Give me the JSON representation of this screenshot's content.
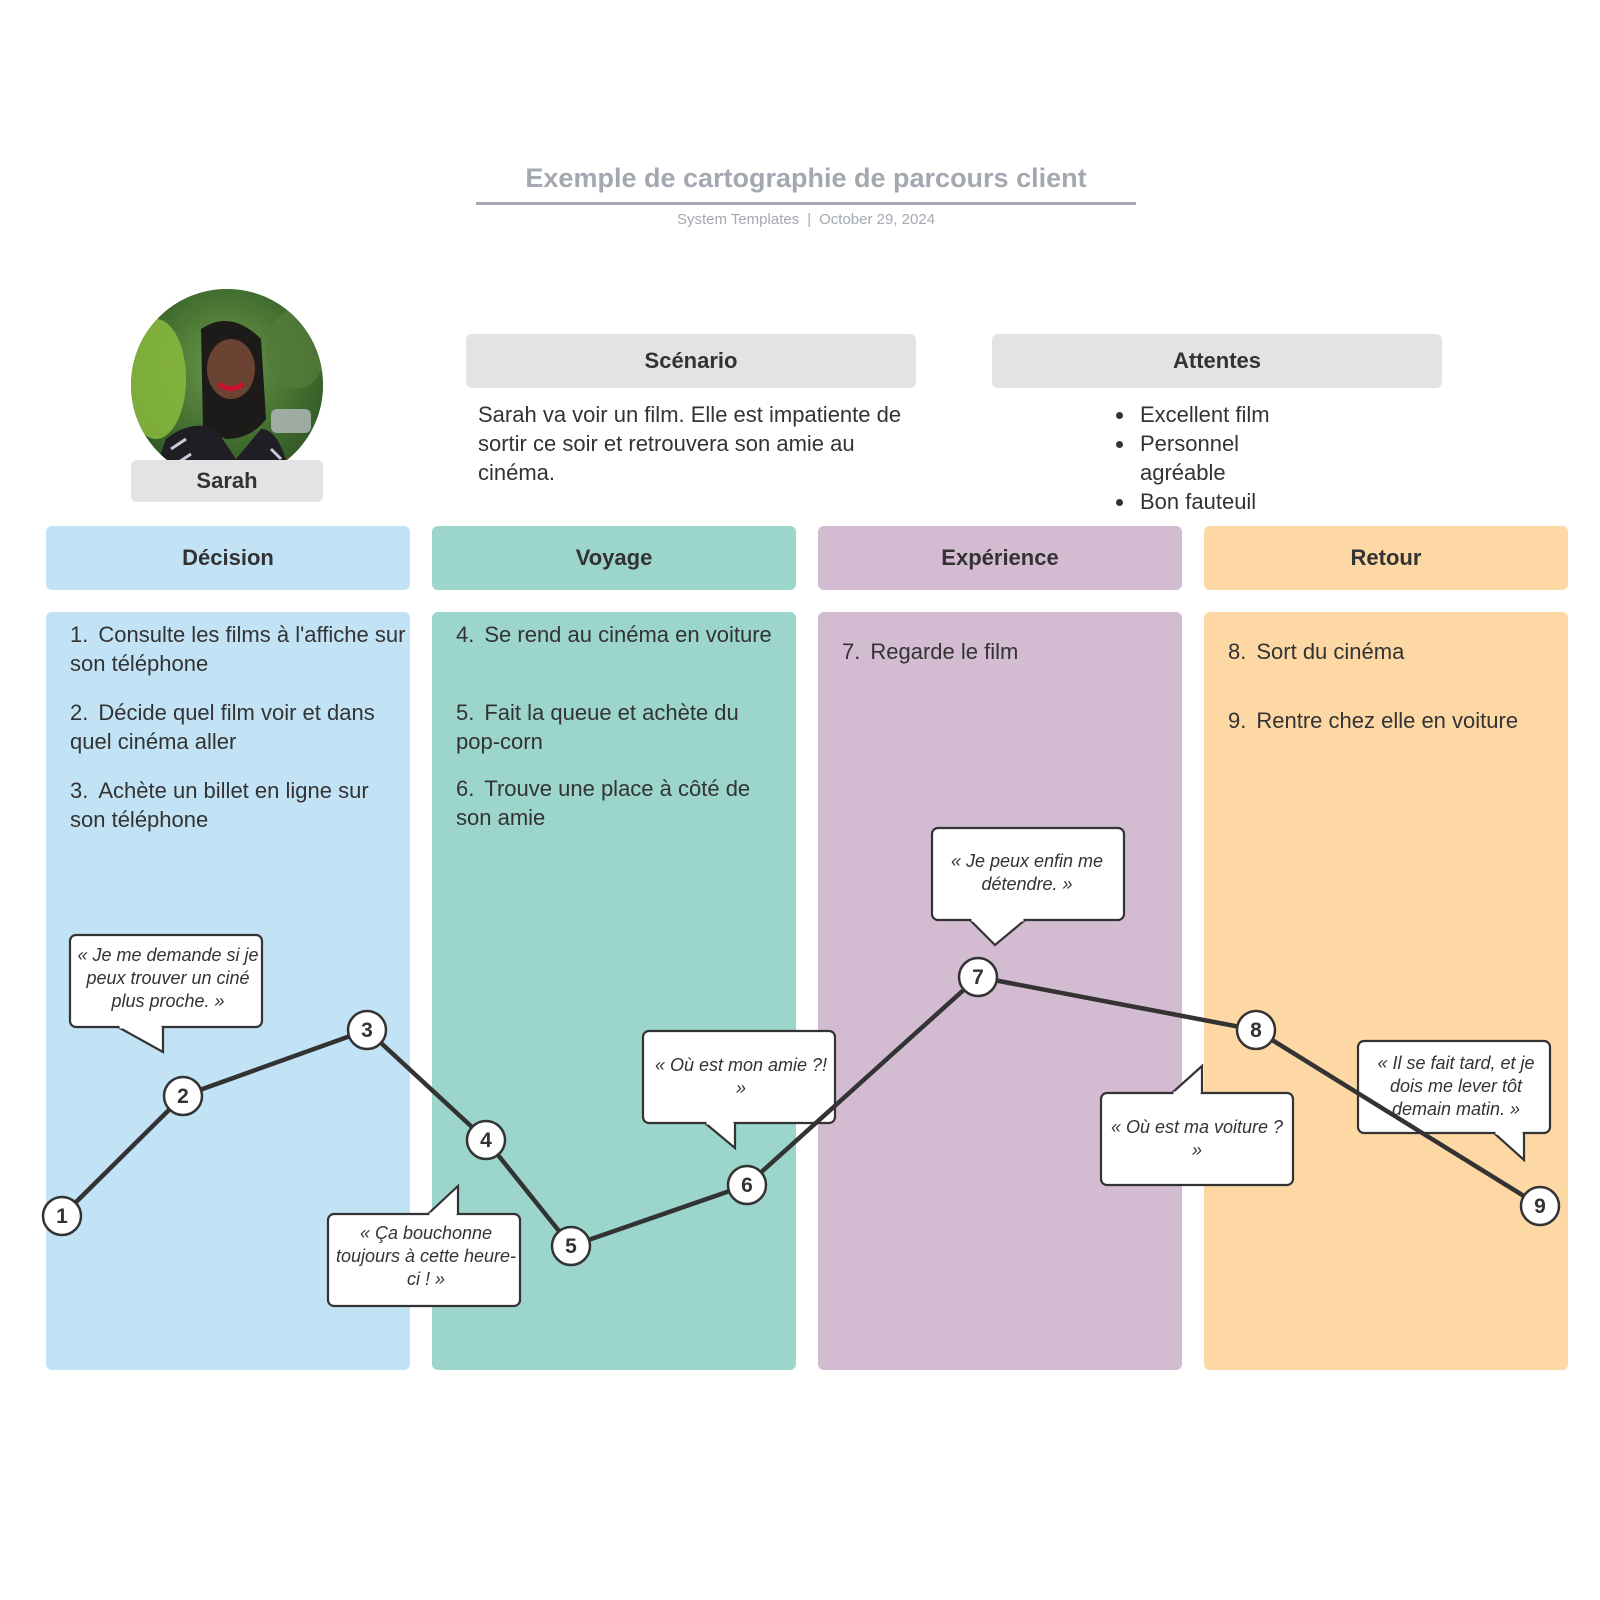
{
  "header": {
    "title": "Exemple de cartographie de parcours client",
    "source": "System Templates",
    "separator": "|",
    "date": "October 29, 2024"
  },
  "persona": {
    "name": "Sarah",
    "photo_icon": "persona-photo"
  },
  "scenario": {
    "heading": "Scénario",
    "text": "Sarah va voir un film. Elle est impatiente de sortir ce soir et retrouvera son amie au cinéma."
  },
  "expectations": {
    "heading": "Attentes",
    "items": [
      "Excellent film",
      "Personnel agréable",
      "Bon fauteuil"
    ]
  },
  "phases": [
    {
      "label": "Décision",
      "color": "#c2e3f5"
    },
    {
      "label": "Voyage",
      "color": "#9bd5cb"
    },
    {
      "label": "Expérience",
      "color": "#d3bbd2"
    },
    {
      "label": "Retour",
      "color": "#fdd8a5"
    }
  ],
  "steps": [
    {
      "num": "1.",
      "text": "Consulte les films à l'affiche sur son téléphone",
      "phase": 0
    },
    {
      "num": "2.",
      "text": "Décide quel film voir et dans quel cinéma aller",
      "phase": 0
    },
    {
      "num": "3.",
      "text": "Achète un billet en ligne sur son téléphone",
      "phase": 0
    },
    {
      "num": "4.",
      "text": "Se rend au cinéma en voiture",
      "phase": 1
    },
    {
      "num": "5.",
      "text": "Fait la queue et achète du pop-corn",
      "phase": 1
    },
    {
      "num": "6.",
      "text": "Trouve une place à côté de son amie",
      "phase": 1
    },
    {
      "num": "7.",
      "text": "Regarde le film",
      "phase": 2
    },
    {
      "num": "8.",
      "text": "Sort du cinéma",
      "phase": 3
    },
    {
      "num": "9.",
      "text": "Rentre chez elle en voiture",
      "phase": 3
    }
  ],
  "journey": {
    "line_color": "#333333",
    "points": [
      {
        "label": "1",
        "step": 1
      },
      {
        "label": "2",
        "step": 2
      },
      {
        "label": "3",
        "step": 3
      },
      {
        "label": "4",
        "step": 4
      },
      {
        "label": "5",
        "step": 5
      },
      {
        "label": "6",
        "step": 6
      },
      {
        "label": "7",
        "step": 7
      },
      {
        "label": "8",
        "step": 8
      },
      {
        "label": "9",
        "step": 9
      }
    ]
  },
  "quotes": [
    {
      "text": "« Je me demande si je peux trouver un ciné plus proche. »",
      "step": 2
    },
    {
      "text": "« Ça bouchonne toujours à cette heure-ci ! »",
      "step": 4
    },
    {
      "text": "« Où est mon amie ?! »",
      "step": 6
    },
    {
      "text": "« Je peux enfin me détendre. »",
      "step": 7
    },
    {
      "text": "« Où est ma voiture ? »",
      "step": 8
    },
    {
      "text": "« Il se fait tard, et je dois me lever tôt demain matin. »",
      "step": 9
    }
  ]
}
